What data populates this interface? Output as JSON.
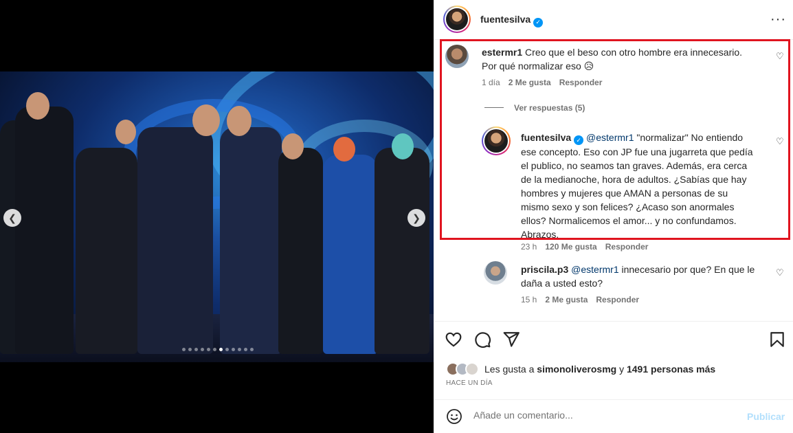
{
  "post": {
    "author": "fuentesilva",
    "more_icon": "more-horizontal-icon"
  },
  "comments": [
    {
      "user": "estermr1",
      "text": "Creo que el beso con otro hombre era innecesario.",
      "text2": "Por qué normalizar eso 😥",
      "time": "1 día",
      "likes": "2 Me gusta",
      "reply": "Responder"
    }
  ],
  "view_replies": "Ver respuestas (5)",
  "reply": {
    "user": "fuentesilva",
    "mention": "@estermr1",
    "lines": [
      "\"normalizar\" No entiendo",
      "ese concepto. Eso con JP fue una jugarreta que pedía",
      "el publico, no seamos tan graves. Además, era cerca",
      "de la medianoche, hora de adultos. ¿Sabías que hay",
      "hombres y mujeres que AMAN a personas de su",
      "mismo sexo y son felices? ¿Acaso son anormales",
      "ellos? Normalicemos el amor... y no confundamos.",
      "Abrazos."
    ],
    "time": "23 h",
    "likes": "120 Me gusta",
    "reply_label": "Responder"
  },
  "reply2": {
    "user": "priscila.p3",
    "mention": "@estermr1",
    "text": "innecesario por que? En que le",
    "text2": "daña a usted esto?",
    "time": "15 h",
    "likes": "2 Me gusta",
    "reply_label": "Responder"
  },
  "likes_summary": {
    "prefix": "Les gusta a",
    "user": "simonoliverosmg",
    "middle": "y",
    "count": "1491 personas más"
  },
  "time_ago": "HACE UN DÍA",
  "add_comment": {
    "placeholder": "Añade un comentario...",
    "post_label": "Publicar"
  },
  "colors": {
    "highlight": "#e0141f",
    "verified": "#0095f6",
    "mention": "#00376b",
    "post_disabled": "#b2dffc"
  }
}
